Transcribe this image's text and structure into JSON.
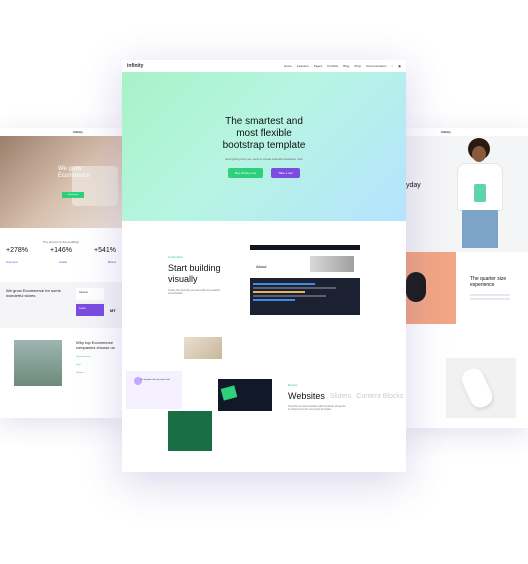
{
  "left_panel": {
    "logo": "Infinity",
    "hero_title_1": "We grow",
    "hero_title_2": "Ecommerce",
    "hero_button": "Read more",
    "stats_title": "The proof is in the pudding!",
    "stats": [
      {
        "value": "+278%"
      },
      {
        "value": "+146%"
      },
      {
        "value": "+541%"
      }
    ],
    "brands": [
      "Anymore",
      "Adeal",
      "Brand"
    ],
    "section_title": "We grow Ecommerce for some wonderful stores",
    "partner_names": [
      "WEBSITE",
      "BRAND",
      "MT"
    ],
    "why_title": "Why top Ecommerce companies choose us",
    "features": [
      {
        "title": "Ecommerce first"
      },
      {
        "title": "Deep"
      },
      {
        "title": "Marketer"
      }
    ]
  },
  "main_panel": {
    "logo": "infinity",
    "menu": [
      "Home",
      "Features",
      "Pages",
      "Portfolio",
      "Blog",
      "Shop",
      "Documentation"
    ],
    "hero_title_line1": "The smartest and",
    "hero_title_line2": "most flexible",
    "hero_title_line3": "bootstrap template",
    "hero_subtitle": "Everything that you need to create beautiful websites, fast",
    "buttons": {
      "primary": "Buy Infinity now",
      "secondary": "Take a tour"
    },
    "feature_label": "Customizer",
    "feature_title_1": "Start building",
    "feature_title_2": "visually",
    "feature_text": "Create the look that you want with our powerful visual builder",
    "code_window_title": "About",
    "websites_label": "Demos",
    "websites_tabs": [
      "Websites",
      "Sliders",
      "Content Blocks"
    ],
    "websites_text": "Powerful pre-built websites with hundreds of layouts to choose from for every kind of project",
    "card_text": "The template with the perfect look"
  },
  "right_panel": {
    "logo": "Infinity",
    "hero_word": "yday",
    "section_title_1": "The quarter size",
    "section_title_2": "experience"
  },
  "colors": {
    "accent_green": "#2fd07b",
    "accent_purple": "#7a4de0",
    "hero_gradient_start": "#a7f2c7",
    "hero_gradient_end": "#b6e3ff"
  }
}
